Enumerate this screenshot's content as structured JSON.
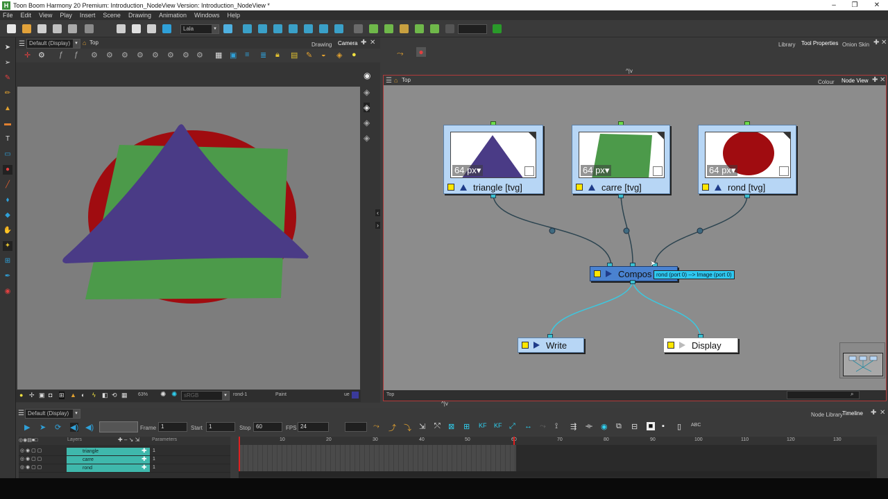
{
  "window": {
    "title": "Toon Boom Harmony 20 Premium: Introduction_NodeView Version: Introduction_NodeView *",
    "controls": [
      "–",
      "❐",
      "✕"
    ]
  },
  "menu": [
    "File",
    "Edit",
    "View",
    "Play",
    "Insert",
    "Scene",
    "Drawing",
    "Animation",
    "Windows",
    "Help"
  ],
  "toolbar": {
    "color_combo": "Lala"
  },
  "camera_panel": {
    "display_combo": "Default (Display)",
    "breadcrumb": "Top",
    "tabs": [
      "Drawing",
      "Camera"
    ],
    "zoom": "63%",
    "color_space": "sRGB",
    "current_drawing": "rond-1",
    "mode": "Paint",
    "status_extra": "ue"
  },
  "right_dock": {
    "tabs": [
      "Library",
      "Tool Properties",
      "Onion Skin"
    ]
  },
  "node_view": {
    "breadcrumb": "Top",
    "tabs": [
      "Colour",
      "Node View"
    ],
    "status_path": "Top",
    "nodes": [
      {
        "label": "triangle  [tvg]",
        "size": "64 px"
      },
      {
        "label": "carre  [tvg]",
        "size": "64 px"
      },
      {
        "label": "rond  [tvg]",
        "size": "64 px"
      }
    ],
    "composite_label": "Compos",
    "tooltip": "rond (port 0) --> Image (port 0)",
    "write_label": "Write",
    "display_label": "Display"
  },
  "timeline": {
    "display_combo": "Default (Display)",
    "tabs": [
      "Node Library",
      "Timeline"
    ],
    "frame_label": "Frame",
    "frame_value": "1",
    "start_label": "Start",
    "start_value": "1",
    "stop_label": "Stop",
    "stop_value": "60",
    "fps_label": "FPS",
    "fps_value": "24",
    "layers_header": "Layers",
    "params_header": "Parameters",
    "layers": [
      {
        "name": "triangle",
        "value": "1"
      },
      {
        "name": "carre",
        "value": "1"
      },
      {
        "name": "rond",
        "value": "1"
      }
    ],
    "ruler": [
      "10",
      "20",
      "30",
      "40",
      "50",
      "60",
      "70",
      "80",
      "90",
      "100",
      "110",
      "120",
      "130"
    ]
  },
  "colors": {
    "triangle": "#4a3b86",
    "carre": "#4c9a4a",
    "rond": "#a00c10",
    "node_fill": "#b7d6f5",
    "port": "#3cc0d0",
    "selection_border": "#b33a3a"
  }
}
